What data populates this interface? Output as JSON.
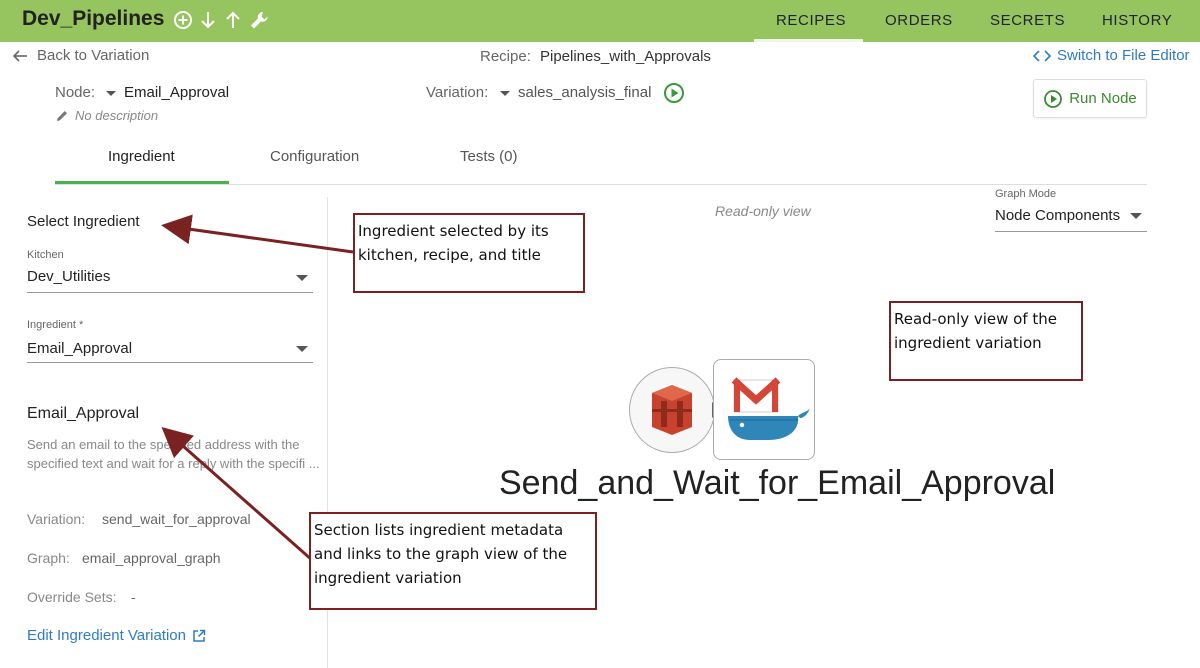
{
  "app": {
    "title": "Dev_Pipelines",
    "nav": [
      "RECIPES",
      "ORDERS",
      "SECRETS",
      "HISTORY"
    ]
  },
  "header": {
    "back_label": "Back to Variation",
    "recipe_label": "Recipe:",
    "recipe_value": "Pipelines_with_Approvals",
    "switch_label": "Switch to File Editor",
    "node_label": "Node:",
    "node_value": "Email_Approval",
    "description": "No description",
    "variation_label": "Variation:",
    "variation_value": "sales_analysis_final",
    "run_node_label": "Run Node"
  },
  "tabs": [
    "Ingredient",
    "Configuration",
    "Tests (0)"
  ],
  "left_panel": {
    "heading": "Select Ingredient",
    "kitchen_label": "Kitchen",
    "kitchen_value": "Dev_Utilities",
    "ingredient_label": "Ingredient *",
    "ingredient_value": "Email_Approval",
    "ingredient_title": "Email_Approval",
    "ingredient_desc": "Send an email to the specified address with the specified text and wait for a reply with the specifi ...",
    "variation_label": "Variation:",
    "variation_value": "send_wait_for_approval",
    "graph_label": "Graph:",
    "graph_value": "email_approval_graph",
    "override_label": "Override Sets:",
    "override_value": "-",
    "edit_link": "Edit Ingredient Variation"
  },
  "graph": {
    "readonly_label": "Read-only view",
    "mode_label": "Graph Mode",
    "mode_value": "Node Components",
    "node_name": "Send_and_Wait_for_Email_Approval"
  },
  "annotations": {
    "a1": [
      "Ingredient selected by its",
      "kitchen, recipe, and title"
    ],
    "a2": [
      "Read-only view of the",
      "ingredient variation"
    ],
    "a3": [
      "Section lists ingredient metadata",
      "and links to the graph view of the",
      "ingredient variation"
    ]
  },
  "colors": {
    "topbar": "#96c45e",
    "accent_green": "#4caf50",
    "link_blue": "#2f7bc2",
    "annotation_border": "#7a2222"
  }
}
